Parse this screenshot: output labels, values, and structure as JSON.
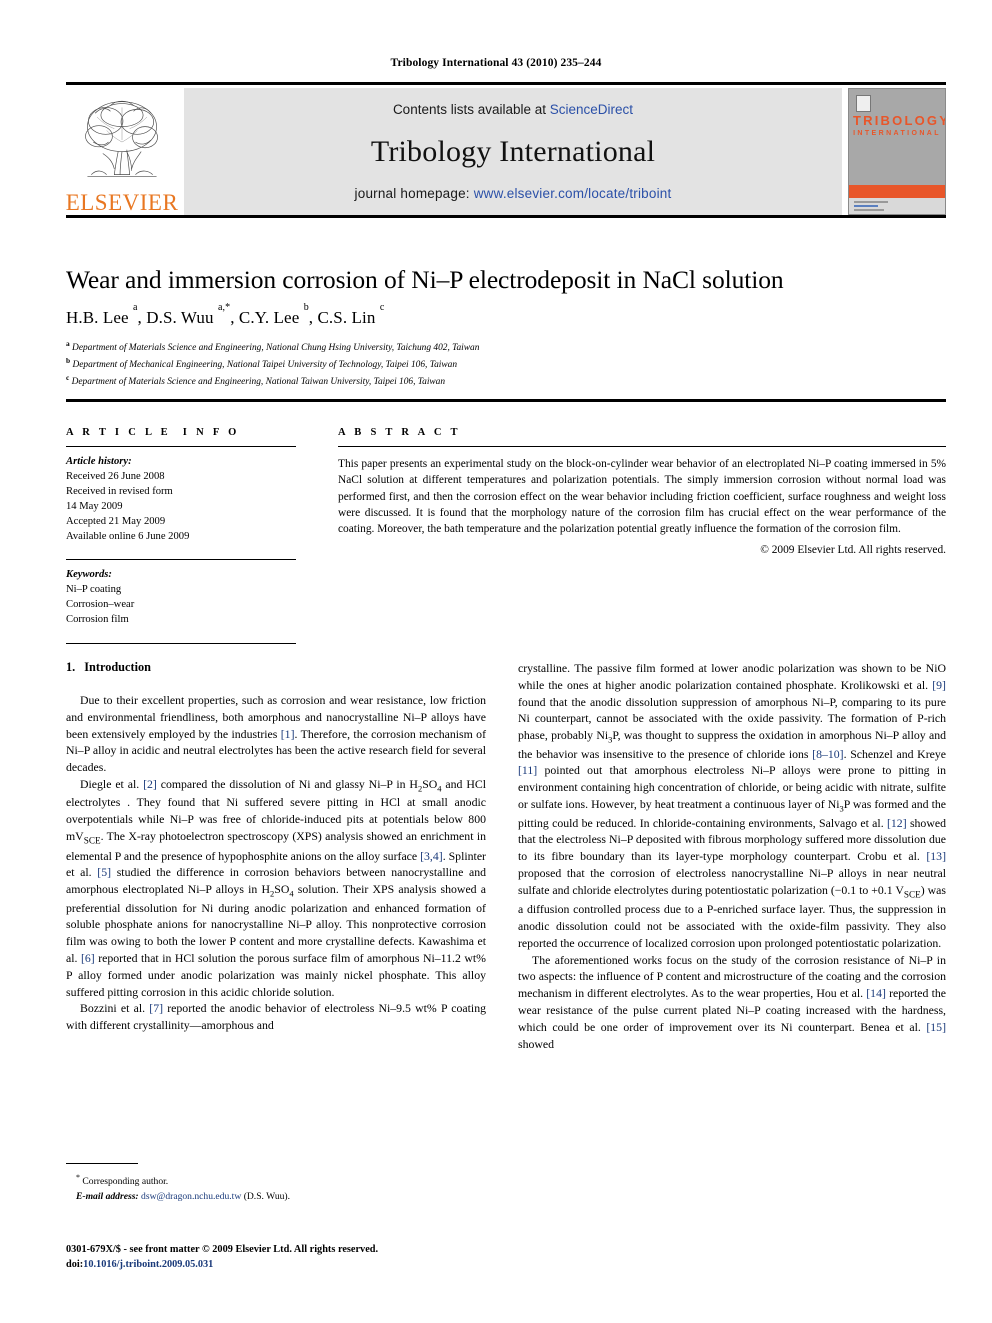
{
  "running_head": "Tribology International 43 (2010) 235–244",
  "masthead": {
    "publisher_logo_name": "ELSEVIER",
    "contents_prefix": "Contents lists available at ",
    "contents_link": "ScienceDirect",
    "journal_name": "Tribology International",
    "homepage_label": "journal homepage: ",
    "homepage_url": "www.elsevier.com/locate/triboint",
    "cover": {
      "title": "TRIBOLOGY",
      "subtitle": "INTERNATIONAL"
    },
    "accent_color": "#E87722",
    "link_color": "#2b50a8",
    "panel_color": "#e3e3e3"
  },
  "article": {
    "title": "Wear and immersion corrosion of Ni–P electrodeposit in NaCl solution",
    "authors_html": "H.B. Lee <sup>a</sup>, D.S. Wuu <sup>a,*</sup>, C.Y. Lee <sup>b</sup>, C.S. Lin <sup>c</sup>",
    "affiliations": [
      {
        "marker": "a",
        "text": "Department of Materials Science and Engineering, National Chung Hsing University, Taichung 402, Taiwan"
      },
      {
        "marker": "b",
        "text": "Department of Mechanical Engineering, National Taipei University of Technology, Taipei 106, Taiwan"
      },
      {
        "marker": "c",
        "text": "Department of Materials Science and Engineering, National Taiwan University, Taipei 106, Taiwan"
      }
    ]
  },
  "article_info": {
    "heading": "ARTICLE INFO",
    "history_label": "Article history:",
    "history_lines": [
      "Received 26 June 2008",
      "Received in revised form",
      "14 May 2009",
      "Accepted 21 May 2009",
      "Available online 6 June 2009"
    ],
    "keywords_label": "Keywords:",
    "keywords": [
      "Ni–P coating",
      "Corrosion–wear",
      "Corrosion film"
    ]
  },
  "abstract": {
    "heading": "ABSTRACT",
    "text": "This paper presents an experimental study on the block-on-cylinder wear behavior of an electroplated Ni–P coating immersed in 5% NaCl solution at different temperatures and polarization potentials. The simply immersion corrosion without normal load was performed first, and then the corrosion effect on the wear behavior including friction coefficient, surface roughness and weight loss were discussed. It is found that the morphology nature of the corrosion film has crucial effect on the wear performance of the coating. Moreover, the bath temperature and the polarization potential greatly influence the formation of the corrosion film.",
    "copyright": "© 2009 Elsevier Ltd. All rights reserved."
  },
  "body": {
    "section_number": "1.",
    "section_title": "Introduction",
    "left_paragraphs": [
      "Due to their excellent properties, such as corrosion and wear resistance, low friction and environmental friendliness, both amorphous and nanocrystalline Ni–P alloys have been extensively employed by the industries [1]. Therefore, the corrosion mechanism of Ni–P alloy in acidic and neutral electrolytes has been the active research field for several decades.",
      "Diegle et al. [2] compared the dissolution of Ni and glassy Ni–P in H2SO4 and HCl electrolytes . They found that Ni suffered severe pitting in HCl at small anodic overpotentials while Ni–P was free of chloride-induced pits at potentials below 800 mVSCE. The X-ray photoelectron spectroscopy (XPS) analysis showed an enrichment in elemental P and the presence of hypophosphite anions on the alloy surface [3,4]. Splinter et al. [5] studied the difference in corrosion behaviors between nanocrystalline and amorphous electroplated Ni–P alloys in H2SO4 solution. Their XPS analysis showed a preferential dissolution for Ni during anodic polarization and enhanced formation of soluble phosphate anions for nanocrystalline Ni–P alloy. This nonprotective corrosion film was owing to both the lower P content and more crystalline defects. Kawashima et al. [6] reported that in HCl solution the porous surface film of amorphous Ni–11.2 wt% P alloy formed under anodic polarization was mainly nickel phosphate. This alloy suffered pitting corrosion in this acidic chloride solution.",
      "Bozzini et al. [7] reported the anodic behavior of electroless Ni–9.5 wt% P coating with different crystallinity—amorphous and"
    ],
    "right_paragraphs": [
      "crystalline. The passive film formed at lower anodic polarization was shown to be NiO while the ones at higher anodic polarization contained phosphate. Krolikowski et al. [9] found that the anodic dissolution suppression of amorphous Ni–P, comparing to its pure Ni counterpart, cannot be associated with the oxide passivity. The formation of P-rich phase, probably Ni3P, was thought to suppress the oxidation in amorphous Ni–P alloy and the behavior was insensitive to the presence of chloride ions [8–10]. Schenzel and Kreye [11] pointed out that amorphous electroless Ni–P alloys were prone to pitting in environment containing high concentration of chloride, or being acidic with nitrate, sulfite or sulfate ions. However, by heat treatment a continuous layer of Ni3P was formed and the pitting could be reduced. In chloride-containing environments, Salvago et al. [12] showed that the electroless Ni–P deposited with fibrous morphology suffered more dissolution due to its fibre boundary than its layer-type morphology counterpart. Crobu et al. [13] proposed that the corrosion of electroless nanocrystalline Ni–P alloys in near neutral sulfate and chloride electrolytes during potentiostatic polarization (−0.1 to +0.1 VSCE) was a diffusion controlled process due to a P-enriched surface layer. Thus, the suppression in anodic dissolution could not be associated with the oxide-film passivity. They also reported the occurrence of localized corrosion upon prolonged potentiostatic polarization.",
      "The aforementioned works focus on the study of the corrosion resistance of Ni–P in two aspects: the influence of P content and microstructure of the coating and the corrosion mechanism in different electrolytes. As to the wear properties, Hou et al. [14] reported the wear resistance of the pulse current plated Ni–P coating increased with the hardness, which could be one order of improvement over its Ni counterpart. Benea et al. [15] showed"
    ]
  },
  "footnote": {
    "marker": "*",
    "corresponding": "Corresponding author.",
    "email_label": "E-mail address:",
    "email": "dsw@dragon.nchu.edu.tw",
    "email_owner": "(D.S. Wuu)."
  },
  "page_footer": {
    "issn_line": "0301-679X/$ - see front matter © 2009 Elsevier Ltd. All rights reserved.",
    "doi_label": "doi:",
    "doi": "10.1016/j.triboint.2009.05.031"
  }
}
